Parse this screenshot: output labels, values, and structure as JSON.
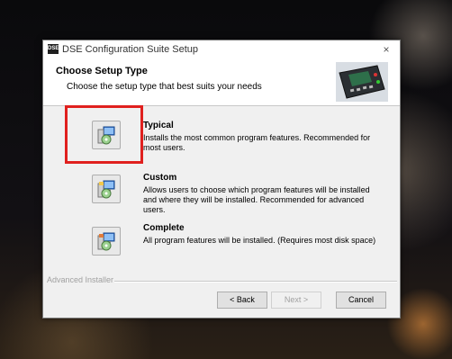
{
  "window": {
    "app_icon_text": "DSE",
    "title": "DSE Configuration Suite Setup",
    "close_symbol": "×"
  },
  "header": {
    "title": "Choose Setup Type",
    "subtitle": "Choose the setup type that best suits your needs"
  },
  "options": [
    {
      "title": "Typical",
      "description": "Installs the most common program features. Recommended for most users.",
      "icon": "setup-typical-icon"
    },
    {
      "title": "Custom",
      "description": "Allows users to choose which program features will be installed and where they will be installed. Recommended for advanced users.",
      "icon": "setup-custom-icon"
    },
    {
      "title": "Complete",
      "description": "All program features will be installed.  (Requires most disk space)",
      "icon": "setup-complete-icon"
    }
  ],
  "footer": {
    "brand": "Advanced Installer",
    "back_label": "< Back",
    "next_label": "Next >",
    "cancel_label": "Cancel"
  },
  "colors": {
    "highlight": "#e0201e",
    "dialog_bg": "#f0f0f0"
  }
}
